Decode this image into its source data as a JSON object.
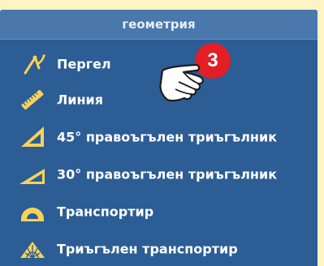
{
  "panel": {
    "header_title": "геометрия"
  },
  "menu": {
    "items": [
      {
        "label": "Пергел",
        "icon": "compass-icon"
      },
      {
        "label": "Линия",
        "icon": "ruler-icon"
      },
      {
        "label": "45° правоъгълен триъгълник",
        "icon": "set-square-45-icon"
      },
      {
        "label": "30° правоъгълен триъгълник",
        "icon": "set-square-30-icon"
      },
      {
        "label": "Транспортир",
        "icon": "protractor-icon"
      },
      {
        "label": "Триъгълен транспортир",
        "icon": "triangular-protractor-icon"
      }
    ]
  },
  "annotation": {
    "badge_number": "3",
    "badge_color": "#e31e24",
    "pointer_icon": "pointing-hand-icon"
  },
  "colors": {
    "background": "#fdf3c3",
    "panel": "#2c5d94",
    "header": "#4a78ad",
    "icon_yellow": "#f7d25a"
  }
}
